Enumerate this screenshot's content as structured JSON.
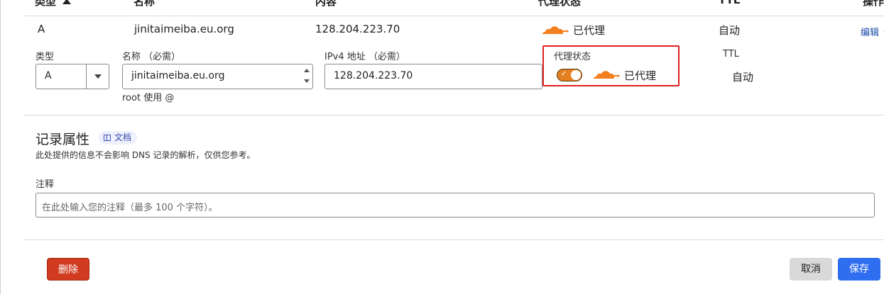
{
  "table_header": {
    "type": "类型",
    "name": "名称",
    "content": "内容",
    "proxy_status": "代理状态",
    "ttl": "TTL",
    "actions": "操作"
  },
  "record_row": {
    "type": "A",
    "name": "jinitaimeiba.eu.org",
    "content": "128.204.223.70",
    "proxy_status": "已代理",
    "ttl": "自动",
    "edit": "编辑"
  },
  "edit_form": {
    "type_label": "类型",
    "type_value": "A",
    "name_label": "名称 （必需）",
    "name_value": "jinitaimeiba.eu.org",
    "name_hint": "root 使用 @",
    "ipv4_label": "IPv4 地址 （必需）",
    "ipv4_value": "128.204.223.70",
    "proxy_label": "代理状态",
    "proxy_value": "已代理",
    "proxy_enabled": true,
    "ttl_label": "TTL",
    "ttl_value": "自动"
  },
  "record_attributes": {
    "title": "记录属性",
    "doc_badge": "文档",
    "description": "此处提供的信息不会影响 DNS 记录的解析，仅供您参考。",
    "comment_label": "注释",
    "comment_placeholder": "在此处输入您的注释（最多 100 个字符）。"
  },
  "buttons": {
    "delete": "删除",
    "cancel": "取消",
    "save": "保存"
  },
  "colors": {
    "cloud_orange": "#f38020",
    "delete_red": "#d13b1f",
    "save_blue": "#2f6ef0",
    "highlight_red": "#e02020"
  }
}
